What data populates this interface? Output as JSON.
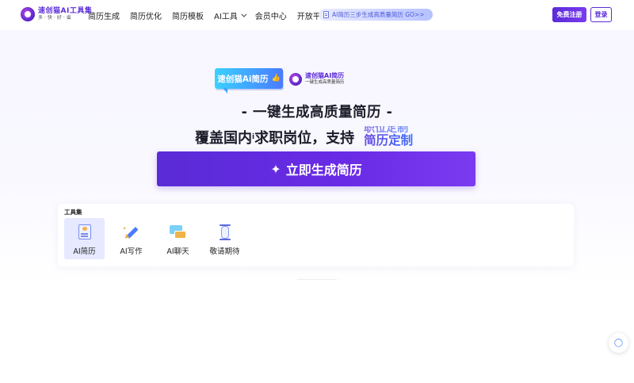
{
  "header": {
    "logo_title": "速创猫AI工具集",
    "logo_sub": "多·快·好·省",
    "nav": [
      {
        "label": "简历生成"
      },
      {
        "label": "简历优化"
      },
      {
        "label": "简历模板"
      },
      {
        "label": "AI工具"
      },
      {
        "label": "会员中心"
      },
      {
        "label": "开放平台"
      }
    ],
    "promo": "AI简历三步生成高质量简历 GO>>",
    "register": "免费注册",
    "login": "登录"
  },
  "hero": {
    "badge": "速创猫Ai简历",
    "brand_title": "速创猫AI简历",
    "brand_sub": "一键生成高质量简历",
    "slogan": "- 一键生成高质量简历 -",
    "line_prefix": "覆盖国内",
    "line_sup": "i",
    "line_suffix": "求职岗位，支持",
    "rotator_prev": "职位定制",
    "rotator_current": "简历定制",
    "cta": "立即生成简历"
  },
  "tools": {
    "title": "工具集",
    "items": [
      {
        "label": "AI简历",
        "icon": "resume-icon",
        "active": true
      },
      {
        "label": "AI写作",
        "icon": "pen-icon",
        "active": false
      },
      {
        "label": "AI聊天",
        "icon": "chat-icon",
        "active": false
      },
      {
        "label": "敬请期待",
        "icon": "hourglass-icon",
        "active": false
      }
    ]
  },
  "colors": {
    "brand": "#5b2bd8",
    "accent_blue": "#4a7bff",
    "active_tool_bg": "#e6e9ff"
  }
}
